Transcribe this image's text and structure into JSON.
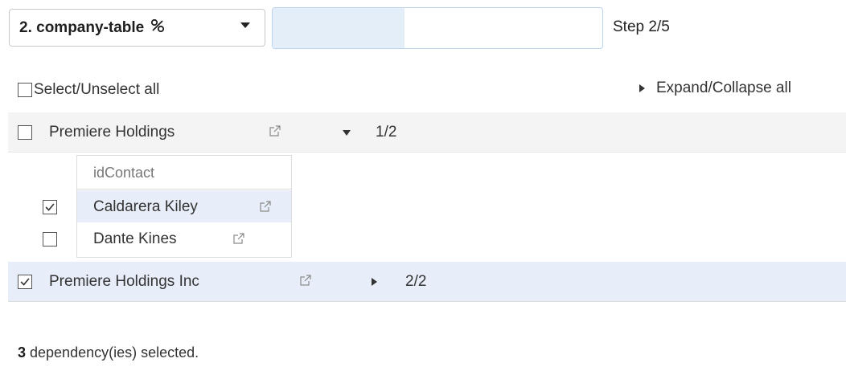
{
  "toolbar": {
    "step_label": "2. company-table",
    "step_icon": "link-icon",
    "progress_fraction": 0.4,
    "step_text": "Step 2/5"
  },
  "controls": {
    "select_all_label": "Select/Unselect all",
    "select_all_checked": false,
    "expand_all_label": "Expand/Collapse all"
  },
  "companies": [
    {
      "name": "Premiere Holdings",
      "checked": false,
      "expanded": true,
      "count": "1/2",
      "dependencies": {
        "column_header": "idContact",
        "rows": [
          {
            "name": "Caldarera Kiley",
            "checked": true,
            "highlighted": true
          },
          {
            "name": "Dante Kines",
            "checked": false,
            "highlighted": false
          }
        ]
      }
    },
    {
      "name": "Premiere Holdings Inc",
      "checked": true,
      "expanded": false,
      "count": "2/2"
    }
  ],
  "footer": {
    "count": "3",
    "text": " dependency(ies) selected."
  },
  "colors": {
    "row_bg": "#f4f4f4",
    "selected_row_bg": "#e8eef9",
    "progress_fill": "#e4eef9",
    "progress_border": "#bcd3ee"
  }
}
